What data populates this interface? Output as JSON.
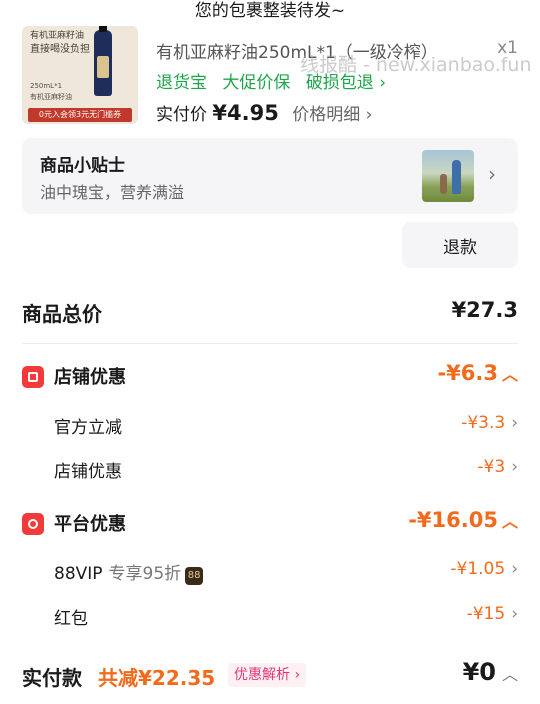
{
  "status": {
    "message": "您的包裹整装待发~"
  },
  "product": {
    "thumb_line1": "有机亚麻籽油",
    "thumb_line2": "直接喝没负担",
    "thumb_spec": "250mL*1",
    "thumb_name": "有机亚麻籽油",
    "thumb_tag": "0元入会领3元无门槛券",
    "title": "有机亚麻籽油250mL*1（一级冷榨）",
    "quantity": "x1",
    "tags": [
      "退货宝",
      "大促价保",
      "破损包退 ›"
    ],
    "price_label": "实付价",
    "price_value": "¥4.95",
    "price_detail": "价格明细 ›"
  },
  "watermark": "线报酷 - new.xianbao.fun",
  "tips": {
    "title": "商品小贴士",
    "subtitle": "油中瑰宝，营养满溢",
    "image_icon": "family-photo"
  },
  "refund_button": "退款",
  "summary": {
    "total_label": "商品总价",
    "total_value": "¥27.3",
    "store_discount": {
      "label": "店铺优惠",
      "value": "-¥6.3",
      "icon": "store-icon",
      "items": [
        {
          "label": "官方立减",
          "value": "-¥3.3"
        },
        {
          "label": "店铺优惠",
          "value": "-¥3"
        }
      ]
    },
    "platform_discount": {
      "label": "平台优惠",
      "value": "-¥16.05",
      "icon": "platform-icon",
      "vip_label": "88VIP",
      "vip_extra": "专享95折",
      "vip_badge": "88",
      "vip_value": "-¥1.05",
      "redpack_label": "红包",
      "redpack_value": "-¥15"
    },
    "pay_label": "实付款",
    "pay_saved": "共减¥22.35",
    "pay_analysis": "优惠解析 ›",
    "pay_value": "¥0"
  },
  "colors": {
    "accent": "#f26a1b",
    "green": "#1ea64a",
    "red_icon": "#f23a3a"
  }
}
